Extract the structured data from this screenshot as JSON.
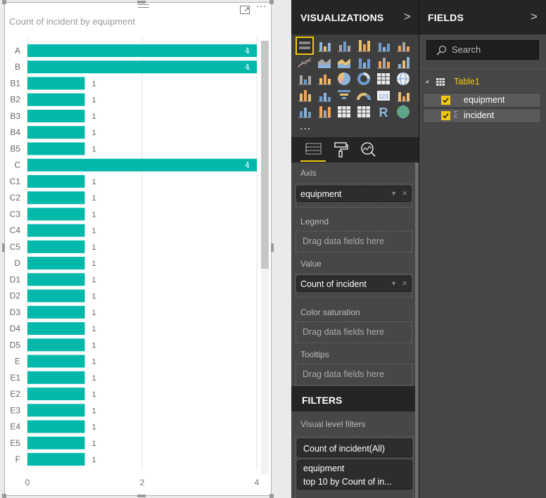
{
  "visual": {
    "title": "Count of incident by equipment",
    "more_label": "···"
  },
  "chart_data": {
    "type": "bar",
    "orientation": "horizontal",
    "title": "Count of incident by equipment",
    "xlabel": "",
    "ylabel": "",
    "categories": [
      "A",
      "B",
      "B1",
      "B2",
      "B3",
      "B4",
      "B5",
      "C",
      "C1",
      "C2",
      "C3",
      "C4",
      "C5",
      "D",
      "D1",
      "D2",
      "D3",
      "D4",
      "D5",
      "E",
      "E1",
      "E2",
      "E3",
      "E4",
      "E5",
      "F"
    ],
    "values": [
      4,
      4,
      1,
      1,
      1,
      1,
      1,
      4,
      1,
      1,
      1,
      1,
      1,
      1,
      1,
      1,
      1,
      1,
      1,
      1,
      1,
      1,
      1,
      1,
      1,
      1
    ],
    "xlim": [
      0,
      4
    ],
    "xticks": [
      0,
      2,
      4
    ],
    "grid": true,
    "data_labels": true,
    "bar_color": "#01b8aa",
    "scrollable": true,
    "scroll_visible_fraction": 0.53
  },
  "visualizations": {
    "title": "VISUALIZATIONS",
    "chevron": ">",
    "gallery_icons": [
      "stacked-bar-chart-icon",
      "stacked-column-chart-icon",
      "clustered-bar-chart-icon",
      "clustered-column-chart-icon",
      "100-stacked-bar-chart-icon",
      "100-stacked-column-chart-icon",
      "line-chart-icon",
      "area-chart-icon",
      "stacked-area-chart-icon",
      "line-stacked-column-chart-icon",
      "line-clustered-column-chart-icon",
      "ribbon-chart-icon",
      "waterfall-chart-icon",
      "scatter-chart-icon",
      "pie-chart-icon",
      "donut-chart-icon",
      "treemap-icon",
      "map-icon",
      "filled-map-icon",
      "shape-map-icon",
      "funnel-icon",
      "gauge-icon",
      "card-icon",
      "multi-row-card-icon",
      "kpi-icon",
      "slicer-icon",
      "table-icon",
      "matrix-icon",
      "r-visual-icon",
      "globe-map-icon"
    ],
    "selected_icon": "stacked-bar-chart-icon",
    "more": "...",
    "tabs": [
      "fields-tab",
      "format-tab",
      "analytics-tab"
    ],
    "active_tab": "fields-tab",
    "wells": {
      "axis": {
        "label": "Axis",
        "field": "equipment"
      },
      "legend": {
        "label": "Legend",
        "placeholder": "Drag data fields here"
      },
      "value": {
        "label": "Value",
        "field": "Count of incident"
      },
      "color_saturation": {
        "label": "Color saturation",
        "placeholder": "Drag data fields here"
      },
      "tooltips": {
        "label": "Tooltips",
        "placeholder": "Drag data fields here"
      }
    }
  },
  "filters": {
    "title": "FILTERS",
    "section": "Visual level filters",
    "cards": [
      {
        "line1": "Count of incident(All)"
      },
      {
        "line1": "equipment",
        "line2": "top 10 by Count of in..."
      }
    ]
  },
  "fields": {
    "title": "FIELDS",
    "chevron": ">",
    "search_placeholder": "Search",
    "table": "Table1",
    "items": [
      {
        "name": "equipment",
        "checked": true,
        "aggregate": false
      },
      {
        "name": "incident",
        "checked": true,
        "aggregate": true,
        "sigma": "Σ"
      }
    ]
  },
  "colors": {
    "accent": "#f2c811",
    "bar": "#01b8aa",
    "pane_bg": "#474747",
    "pane_header": "#252525"
  }
}
